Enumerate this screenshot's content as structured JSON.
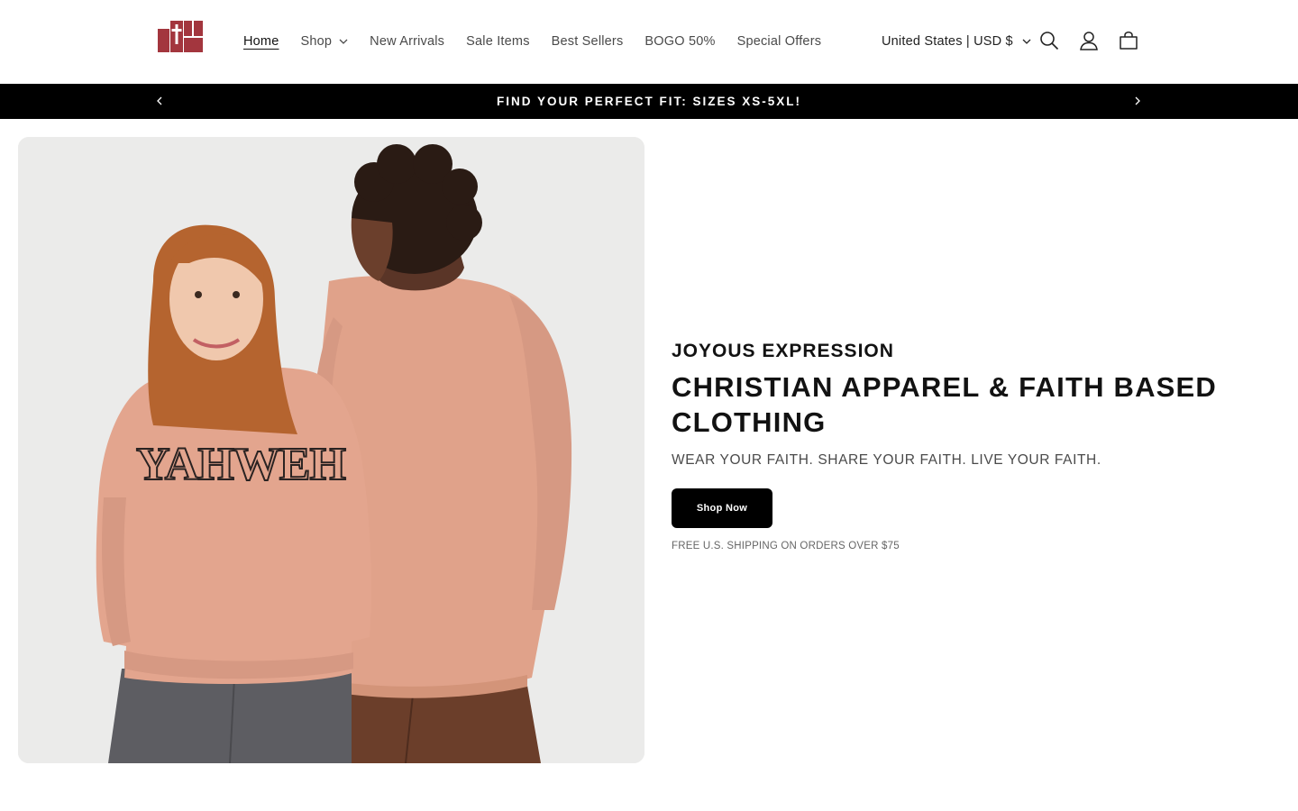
{
  "header": {
    "logo_alt": "cross logo",
    "nav": [
      {
        "label": "Home",
        "active": true
      },
      {
        "label": "Shop",
        "has_dropdown": true
      },
      {
        "label": "New Arrivals"
      },
      {
        "label": "Sale Items"
      },
      {
        "label": "Best Sellers"
      },
      {
        "label": "BOGO 50%"
      },
      {
        "label": "Special Offers"
      }
    ],
    "locale": "United States | USD $",
    "icons": [
      "search-icon",
      "account-icon",
      "cart-icon"
    ]
  },
  "announcement": {
    "text": "FIND YOUR PERFECT FIT: SIZES XS-5XL!"
  },
  "hero": {
    "eyebrow": "JOYOUS EXPRESSION",
    "headline": "CHRISTIAN APPAREL & FAITH BASED CLOTHING",
    "subtitle": "WEAR YOUR FAITH. SHARE YOUR FAITH. LIVE YOUR FAITH.",
    "cta_label": "Shop Now",
    "note": "FREE U.S. SHIPPING ON ORDERS OVER $75",
    "image_print_text": "YAHWEH"
  },
  "colors": {
    "brand": "#a3363e",
    "announcement_bg": "#000000",
    "sweatshirt": "#e1a58e"
  }
}
